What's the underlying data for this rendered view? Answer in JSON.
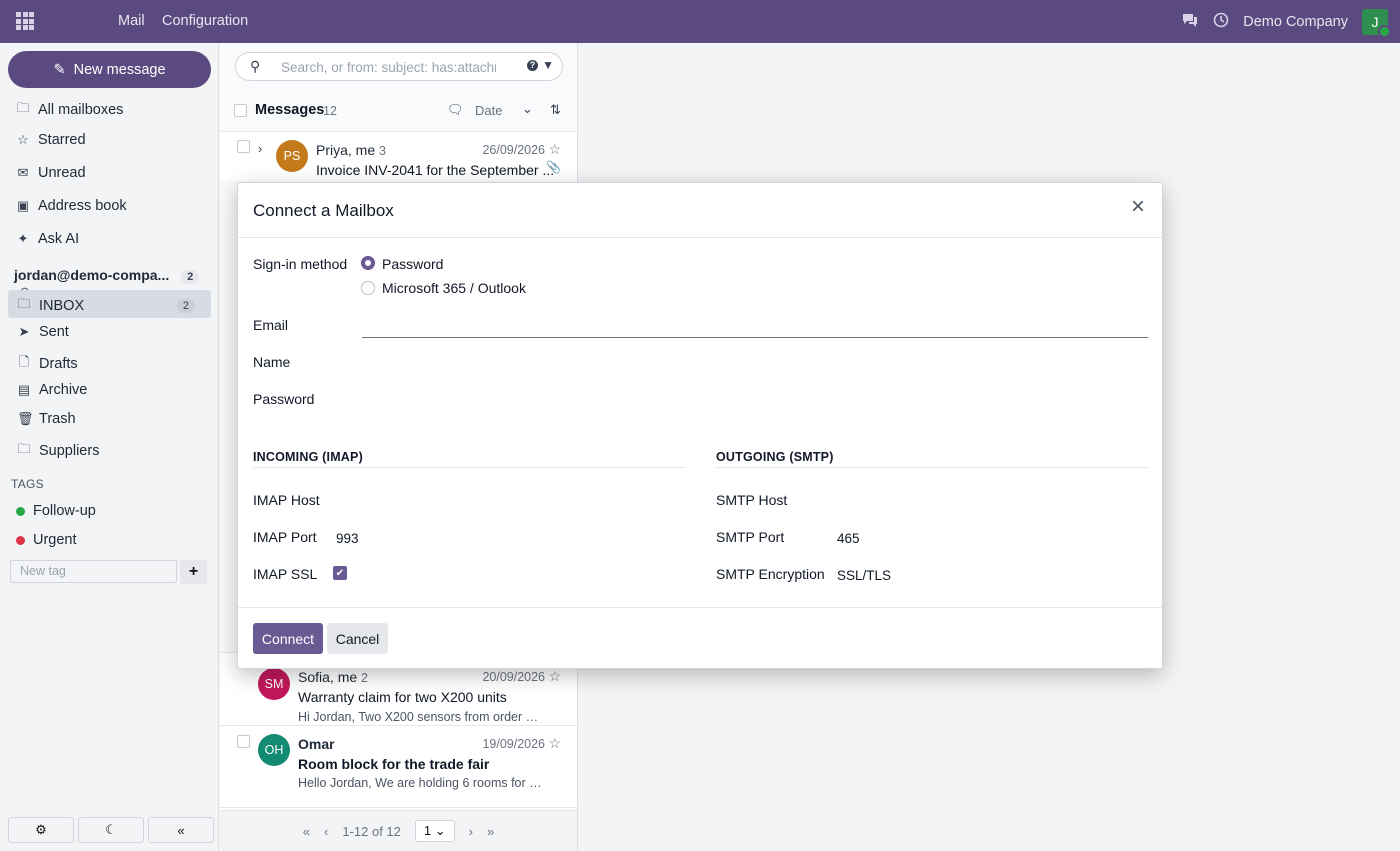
{
  "topbar": {
    "nav": [
      "Mail",
      "Configuration"
    ],
    "company": "Demo Company",
    "avatar_initial": "J"
  },
  "sidebar": {
    "new_message": "New message",
    "items": [
      {
        "label": "All mailboxes",
        "icon": "inbox-icon"
      },
      {
        "label": "Starred",
        "icon": "star-icon"
      },
      {
        "label": "Unread",
        "icon": "envelope-icon"
      },
      {
        "label": "Address book",
        "icon": "address-book-icon"
      },
      {
        "label": "Ask AI",
        "icon": "magic-wand-icon"
      }
    ],
    "account": "jordan@demo-compa...",
    "account_count": "2",
    "folders": [
      {
        "label": "INBOX",
        "count": "2",
        "icon": "inbox-icon"
      },
      {
        "label": "Sent",
        "icon": "paper-plane-icon"
      },
      {
        "label": "Drafts",
        "icon": "file-icon"
      },
      {
        "label": "Archive",
        "icon": "archive-icon"
      },
      {
        "label": "Trash",
        "icon": "trash-icon"
      },
      {
        "label": "Suppliers",
        "icon": "folder-icon"
      }
    ],
    "tags_label": "TAGS",
    "tags": [
      {
        "label": "Follow-up",
        "color": "#28a745"
      },
      {
        "label": "Urgent",
        "color": "#dc3545"
      }
    ],
    "new_tag_placeholder": "New tag"
  },
  "list": {
    "search_placeholder": "Search, or from: subject: has:attachm",
    "header": {
      "title": "Messages",
      "count": "12",
      "sort": "Date"
    },
    "messages": [
      {
        "initials": "PS",
        "color": "#c27a1a",
        "sender": "Priya, me",
        "thread": "3",
        "date": "26/09/2026",
        "subject": "Invoice INV-2041 for the September ...",
        "preview": ""
      },
      {
        "initials": "SM",
        "color": "#c2185b",
        "sender": "Sofia, me",
        "thread": "2",
        "date": "20/09/2026",
        "subject": "Warranty claim for two X200 units",
        "preview": "Hi Jordan, Two X200 sensors from order SO..."
      },
      {
        "initials": "OH",
        "color": "#138a72",
        "sender": "Omar",
        "thread": "",
        "date": "19/09/2026",
        "subject": "Room block for the trade fair",
        "preview": "Hello Jordan, We are holding 6 rooms for y..."
      }
    ],
    "pager": {
      "range": "1-12 of 12",
      "page": "1"
    }
  },
  "modal": {
    "title": "Connect a Mailbox",
    "signin_label": "Sign-in method",
    "options": [
      "Password",
      "Microsoft 365 / Outlook"
    ],
    "selected_option": "Password",
    "email_label": "Email",
    "email_value": "",
    "name_label": "Name",
    "password_label": "Password",
    "incoming_title": "INCOMING (IMAP)",
    "outgoing_title": "OUTGOING (SMTP)",
    "imap_host_label": "IMAP Host",
    "imap_port_label": "IMAP Port",
    "imap_port_value": "993",
    "imap_ssl_label": "IMAP SSL",
    "imap_ssl_checked": true,
    "smtp_host_label": "SMTP Host",
    "smtp_port_label": "SMTP Port",
    "smtp_port_value": "465",
    "smtp_enc_label": "SMTP Encryption",
    "smtp_enc_value": "SSL/TLS",
    "connect": "Connect",
    "cancel": "Cancel"
  }
}
